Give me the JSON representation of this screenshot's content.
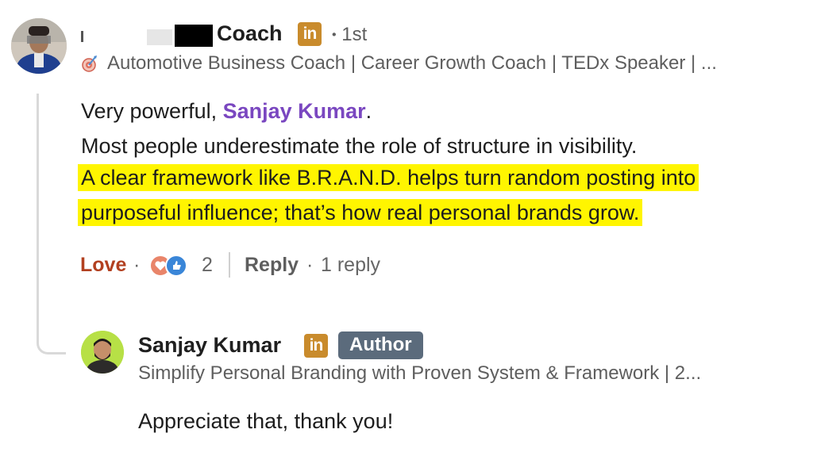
{
  "comment": {
    "author_name": "Coach",
    "connection_degree": "1st",
    "degree_separator": "•",
    "headline": "Automotive Business Coach | Career Growth Coach | TEDx Speaker | ...",
    "body": {
      "line1_prefix": "Very powerful, ",
      "mention": "Sanjay Kumar",
      "line1_suffix": ".",
      "line2": "Most people underestimate the role of structure in visibility.",
      "line3": "A clear framework like B.R.A.N.D. helps turn random posting into",
      "line4": "purposeful influence; that’s how real personal brands grow."
    },
    "actions": {
      "reaction_label": "Love",
      "dot": "·",
      "reaction_count": "2",
      "reply_label": "Reply",
      "reply_dot": "·",
      "reply_count_text": "1 reply"
    },
    "icons": [
      "target-icon",
      "linkedin-badge-icon",
      "heart-reaction-icon",
      "like-reaction-icon"
    ]
  },
  "reply": {
    "author_name": "Sanjay Kumar",
    "author_badge": "Author",
    "headline": "Simplify Personal Branding with Proven System & Framework | 2...",
    "body": "Appreciate that, thank you!"
  },
  "linkedin_badge_text": "in",
  "colors": {
    "highlight": "#fff500",
    "mention": "#7a47c0",
    "love": "#b24020",
    "linkedin_badge": "#c98b2c",
    "author_pill": "#5b6b7c"
  }
}
